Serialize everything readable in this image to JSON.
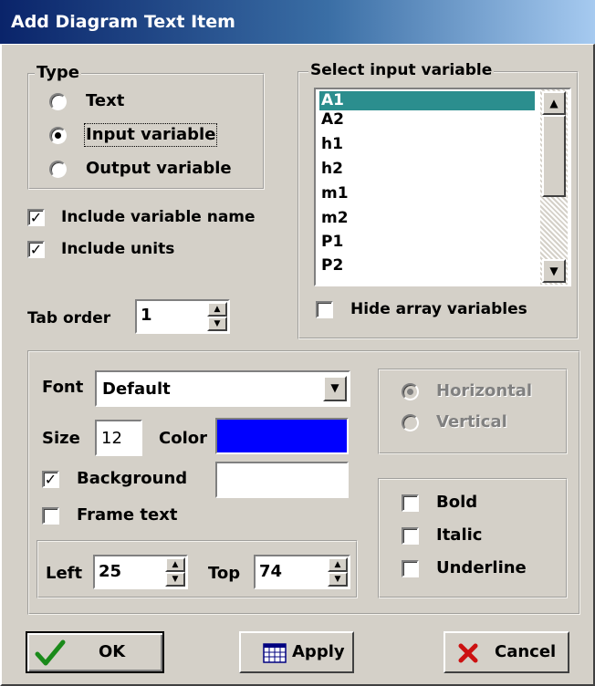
{
  "window": {
    "title": "Add Diagram Text Item"
  },
  "type_group": {
    "legend": "Type",
    "options": [
      "Text",
      "Input variable",
      "Output variable"
    ],
    "selected": "Input variable"
  },
  "include_variable_name": {
    "label": "Include variable name",
    "checked": true
  },
  "include_units": {
    "label": "Include units",
    "checked": true
  },
  "tab_order": {
    "label": "Tab order",
    "value": "1"
  },
  "select_variable": {
    "legend": "Select input variable",
    "items": [
      "A1",
      "A2",
      "h1",
      "h2",
      "m1",
      "m2",
      "P1",
      "P2"
    ],
    "selected": "A1",
    "hide_array": {
      "label": "Hide array variables",
      "checked": false
    }
  },
  "font": {
    "label": "Font",
    "value": "Default"
  },
  "size": {
    "label": "Size",
    "value": "12"
  },
  "color": {
    "label": "Color",
    "value": "#0000ff"
  },
  "background": {
    "label": "Background",
    "checked": true,
    "color": "#ffffff"
  },
  "frame_text": {
    "label": "Frame text",
    "checked": false
  },
  "position": {
    "left_label": "Left",
    "left_value": "25",
    "top_label": "Top",
    "top_value": "74"
  },
  "orientation": {
    "options": [
      "Horizontal",
      "Vertical"
    ],
    "selected": "Horizontal",
    "disabled": true
  },
  "style": {
    "bold": "Bold",
    "italic": "Italic",
    "underline": "Underline"
  },
  "buttons": {
    "ok": "OK",
    "apply": "Apply",
    "cancel": "Cancel"
  }
}
